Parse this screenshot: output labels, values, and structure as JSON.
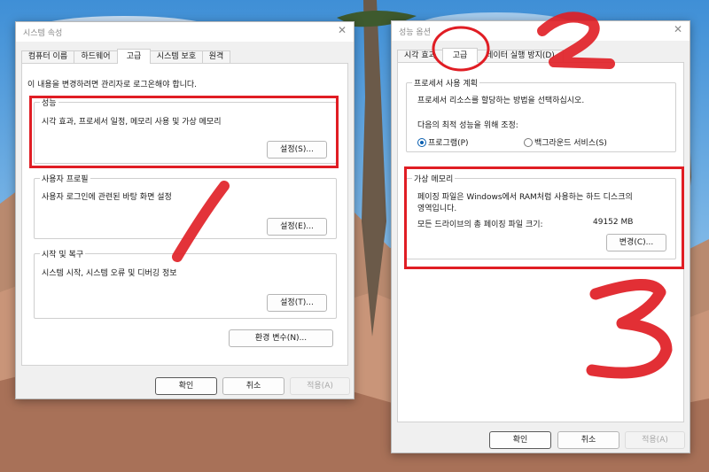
{
  "left_dialog": {
    "title": "시스템 속성",
    "tabs": [
      "컴퓨터 이름",
      "하드웨어",
      "고급",
      "시스템 보호",
      "원격"
    ],
    "notice": "이 내용을 변경하려면 관리자로 로그온해야 합니다.",
    "performance": {
      "legend": "성능",
      "desc": "시각 효과, 프로세서 일정, 메모리 사용 및 가상 메모리",
      "button": "설정(S)..."
    },
    "user_profiles": {
      "legend": "사용자 프로필",
      "desc": "사용자 로그인에 관련된 바탕 화면 설정",
      "button": "설정(E)..."
    },
    "startup_recovery": {
      "legend": "시작 및 복구",
      "desc": "시스템 시작, 시스템 오류 및 디버깅 정보",
      "button": "설정(T)..."
    },
    "env_button": "환경 변수(N)...",
    "footer": {
      "ok": "확인",
      "cancel": "취소",
      "apply": "적용(A)"
    }
  },
  "right_dialog": {
    "title": "성능 옵션",
    "tabs": [
      "시각 효과",
      "고급",
      "데이터 실행 방지(D)"
    ],
    "processor": {
      "legend": "프로세서 사용 계획",
      "desc": "프로세서 리소스를 할당하는 방법을 선택하십시오.",
      "adjust_label": "다음의 최적 성능을 위해 조정:",
      "option_programs": "프로그램(P)",
      "option_background": "백그라운드 서비스(S)",
      "selected": "프로그램(P)"
    },
    "virtual_memory": {
      "legend": "가상 메모리",
      "desc_line1": "페이징 파일은 Windows에서 RAM처럼 사용하는 하드 디스크의",
      "desc_line2": "영역입니다.",
      "total_label": "모든 드라이브의 총 페이징 파일 크기:",
      "total_value": "49152 MB",
      "button": "변경(C)..."
    },
    "footer": {
      "ok": "확인",
      "cancel": "취소",
      "apply": "적용(A)"
    }
  },
  "annotations": {
    "color": "#e01d24",
    "marks": [
      "1",
      "2",
      "3"
    ]
  },
  "icons": {
    "close": "close-icon"
  }
}
